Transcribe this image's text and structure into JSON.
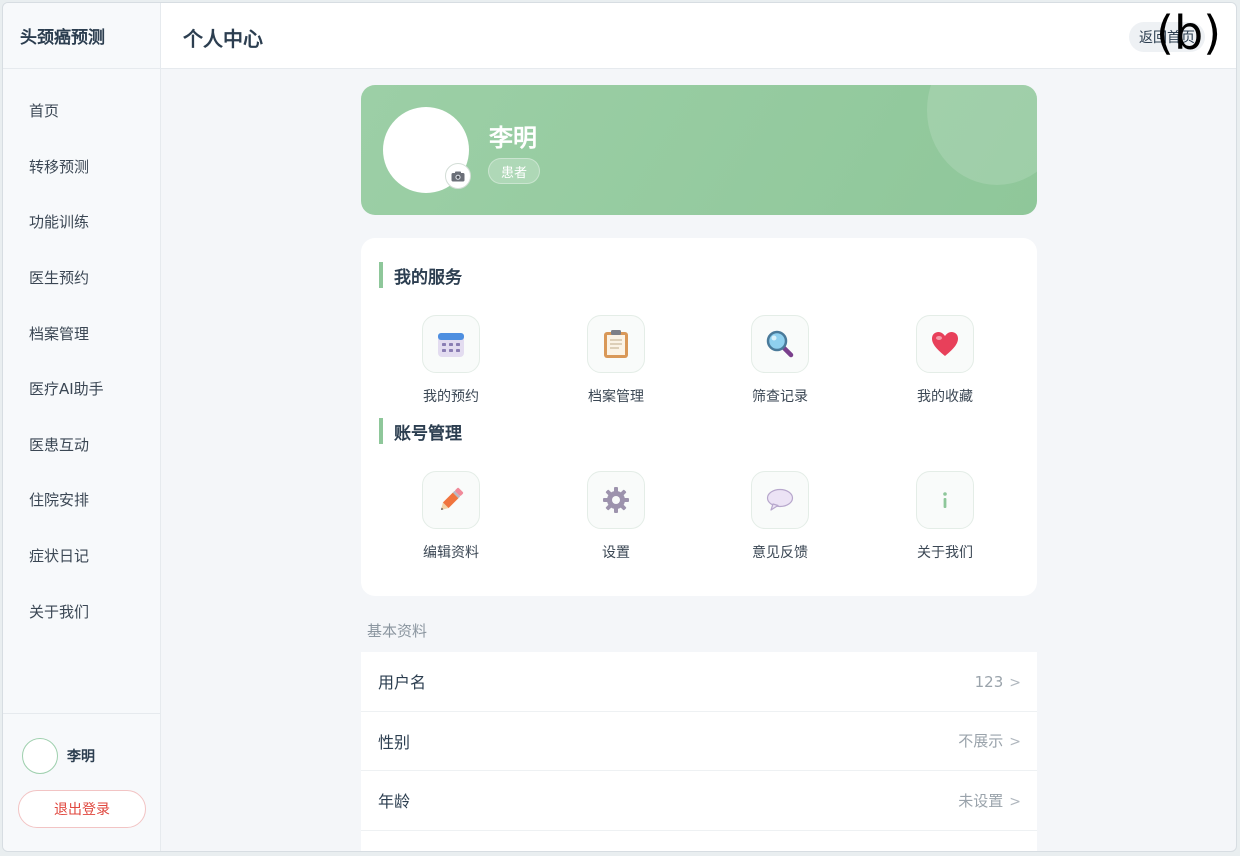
{
  "app": {
    "brand": "头颈癌预测"
  },
  "sidebar": {
    "items": [
      {
        "label": "首页"
      },
      {
        "label": "转移预测"
      },
      {
        "label": "功能训练"
      },
      {
        "label": "医生预约"
      },
      {
        "label": "档案管理"
      },
      {
        "label": "医疗AI助手"
      },
      {
        "label": "医患互动"
      },
      {
        "label": "住院安排"
      },
      {
        "label": "症状日记"
      },
      {
        "label": "关于我们"
      }
    ],
    "user_name": "李明",
    "logout_label": "退出登录"
  },
  "header": {
    "title": "个人中心",
    "back_label": "返回首页",
    "panel_label": "(b)"
  },
  "profile": {
    "name": "李明",
    "role": "患者"
  },
  "services": {
    "title": "我的服务",
    "items": [
      {
        "label": "我的预约",
        "icon": "calendar-icon"
      },
      {
        "label": "档案管理",
        "icon": "clipboard-icon"
      },
      {
        "label": "筛查记录",
        "icon": "magnifier-icon"
      },
      {
        "label": "我的收藏",
        "icon": "heart-icon"
      }
    ]
  },
  "account": {
    "title": "账号管理",
    "items": [
      {
        "label": "编辑资料",
        "icon": "pencil-icon"
      },
      {
        "label": "设置",
        "icon": "gear-icon"
      },
      {
        "label": "意见反馈",
        "icon": "speech-bubble-icon"
      },
      {
        "label": "关于我们",
        "icon": "info-icon"
      }
    ]
  },
  "basic": {
    "title": "基本资料",
    "rows": [
      {
        "label": "用户名",
        "value": "123"
      },
      {
        "label": "性别",
        "value": "不展示"
      },
      {
        "label": "年龄",
        "value": "未设置"
      }
    ],
    "chevron": ">"
  },
  "colors": {
    "accent": "#8ec79a",
    "danger": "#e0473e",
    "heart": "#e8405a"
  }
}
